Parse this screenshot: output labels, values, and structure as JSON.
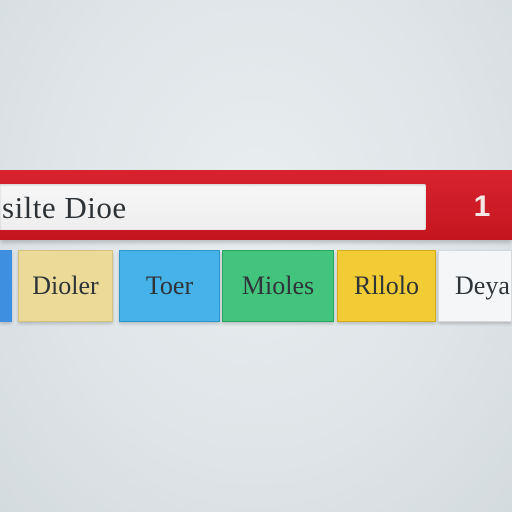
{
  "search": {
    "text": "silte Dioe",
    "badge": "1"
  },
  "tags": [
    {
      "label": "",
      "color": "#3f8fe0"
    },
    {
      "label": "Dioler",
      "color": "#ecdb98"
    },
    {
      "label": "Toer",
      "color": "#46b2ea"
    },
    {
      "label": "Mioles",
      "color": "#43c47c"
    },
    {
      "label": "Rllolo",
      "color": "#f1cc34"
    },
    {
      "label": "Deya",
      "color": "#f5f6f7"
    }
  ],
  "colors": {
    "bar": "#d21f2b",
    "background": "#e3e9ec"
  }
}
